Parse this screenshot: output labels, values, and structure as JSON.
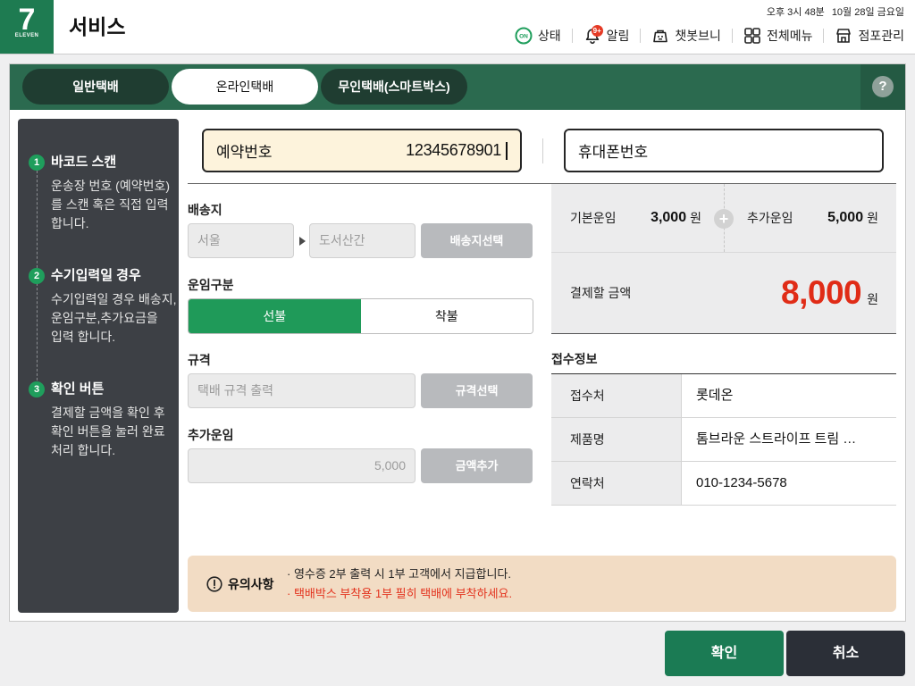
{
  "header": {
    "logo": {
      "number": "7",
      "text": "ELEVEN"
    },
    "title": "서비스",
    "time": "오후 3시 48분",
    "date": "10월 28일 금요일",
    "nav": {
      "status": {
        "icon": "on-status-icon",
        "badge": "ON",
        "label": "상태"
      },
      "alerts": {
        "icon": "bell-icon",
        "badge": "9+",
        "label": "알림"
      },
      "chatbot": {
        "icon": "chatbot-icon",
        "label": "챗봇브니"
      },
      "all_menu": {
        "icon": "grid-icon",
        "label": "전체메뉴"
      },
      "store": {
        "icon": "store-icon",
        "label": "점포관리"
      }
    }
  },
  "tabs": {
    "items": [
      {
        "label": "일반택배"
      },
      {
        "label": "온라인택배"
      },
      {
        "label": "무인택배(스마트박스)"
      }
    ],
    "active_index": 1,
    "help_label": "?"
  },
  "guide": {
    "steps": [
      {
        "number": "1",
        "title": "바코드 스캔",
        "lines": [
          "운송장 번호 (예약번호)",
          "를 스캔 혹은 직접 입력",
          "합니다."
        ]
      },
      {
        "number": "2",
        "title": "수기입력일 경우",
        "lines": [
          "수기입력일 경우 배송지,",
          "운임구분,추가요금을",
          "입력 합니다."
        ]
      },
      {
        "number": "3",
        "title": "확인 버튼",
        "lines": [
          "결제할 금액을 확인 후",
          "확인 버튼을 눌러 완료",
          "처리 합니다."
        ]
      }
    ]
  },
  "lookup": {
    "reservation": {
      "label": "예약번호",
      "value": "12345678901"
    },
    "phone": {
      "label": "휴대폰번호"
    }
  },
  "form": {
    "destination": {
      "label": "배송지",
      "region": "서울",
      "area": "도서산간",
      "button": "배송지선택"
    },
    "fare_type": {
      "label": "운임구분",
      "options": [
        "선불",
        "착불"
      ],
      "selected": "선불"
    },
    "size": {
      "label": "규격",
      "placeholder": "택배 규격 출력",
      "button": "규격선택"
    },
    "extra_fare": {
      "label": "추가운임",
      "value": "5,000",
      "button": "금액추가"
    }
  },
  "fare_summary": {
    "base": {
      "label": "기본운임",
      "amount": "3,000",
      "unit": "원"
    },
    "plus": "+",
    "extra": {
      "label": "추가운임",
      "amount": "5,000",
      "unit": "원"
    },
    "total": {
      "label": "결제할 금액",
      "amount": "8,000",
      "unit": "원"
    }
  },
  "receipt": {
    "title": "접수정보",
    "rows": [
      {
        "label": "접수처",
        "value": "롯데온"
      },
      {
        "label": "제품명",
        "value": "톰브라운 스트라이프 트림 …"
      },
      {
        "label": "연락처",
        "value": "010-1234-5678"
      }
    ]
  },
  "notice": {
    "icon": "alert-circle-icon",
    "title": "유의사항",
    "lines": [
      "· 영수증 2부 출력 시 1부 고객에서 지급합니다.",
      "· 택배박스 부착용 1부 필히 택배에 부착하세요."
    ]
  },
  "actions": {
    "confirm": "확인",
    "cancel": "취소"
  },
  "colors": {
    "page_bg": "#efeff0",
    "brand": "#1e7b51",
    "tab_bar": "#2b6a4f",
    "tab_pill": "#1f3d31",
    "help_bg": "#245a43",
    "sidebar": "#3d4045",
    "step_green": "#1f9e5c",
    "selected_green": "#1f9a59",
    "confirm_green": "#1b7b54",
    "cancel_dark": "#2b2f37",
    "total_red": "#e02c17",
    "notice_red": "#e3321d",
    "notice_bg": "#f2dcc4",
    "reservation_bg": "#fdf3dc",
    "panel_grey": "#ececed",
    "button_grey": "#b8babd",
    "alert_red": "#e53a25"
  }
}
